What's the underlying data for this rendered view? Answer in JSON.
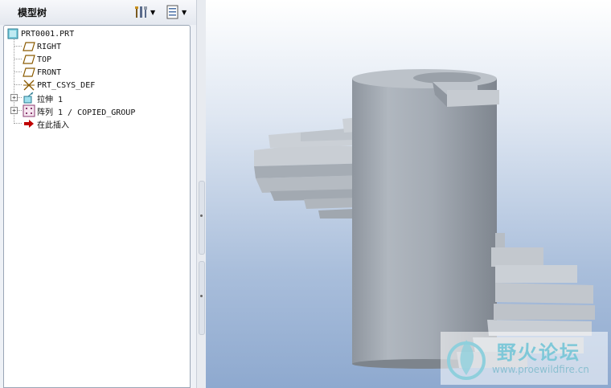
{
  "panel": {
    "title": "模型树",
    "icons": [
      "settings-tools-icon",
      "tree-columns-icon"
    ]
  },
  "tree": {
    "root": "PRT0001.PRT",
    "items": [
      {
        "label": "RIGHT",
        "icon": "datum-plane-icon"
      },
      {
        "label": "TOP",
        "icon": "datum-plane-icon"
      },
      {
        "label": "FRONT",
        "icon": "datum-plane-icon"
      },
      {
        "label": "PRT_CSYS_DEF",
        "icon": "coordinate-system-icon"
      },
      {
        "label": "拉伸 1",
        "icon": "extrude-feature-icon",
        "expandable": true
      },
      {
        "label": "阵列 1 / COPIED_GROUP",
        "icon": "pattern-feature-icon",
        "expandable": true
      },
      {
        "label": "在此插入",
        "icon": "insert-here-arrow-icon"
      }
    ]
  },
  "viewport": {
    "model": "spiral-staircase-model",
    "watermark": {
      "text": "野火论坛",
      "url": "www.proewildfire.cn"
    }
  },
  "colors": {
    "tree_border": "#9aa6b6",
    "model_gray": "#a9b0b8",
    "insert_arrow": "#c00000"
  }
}
